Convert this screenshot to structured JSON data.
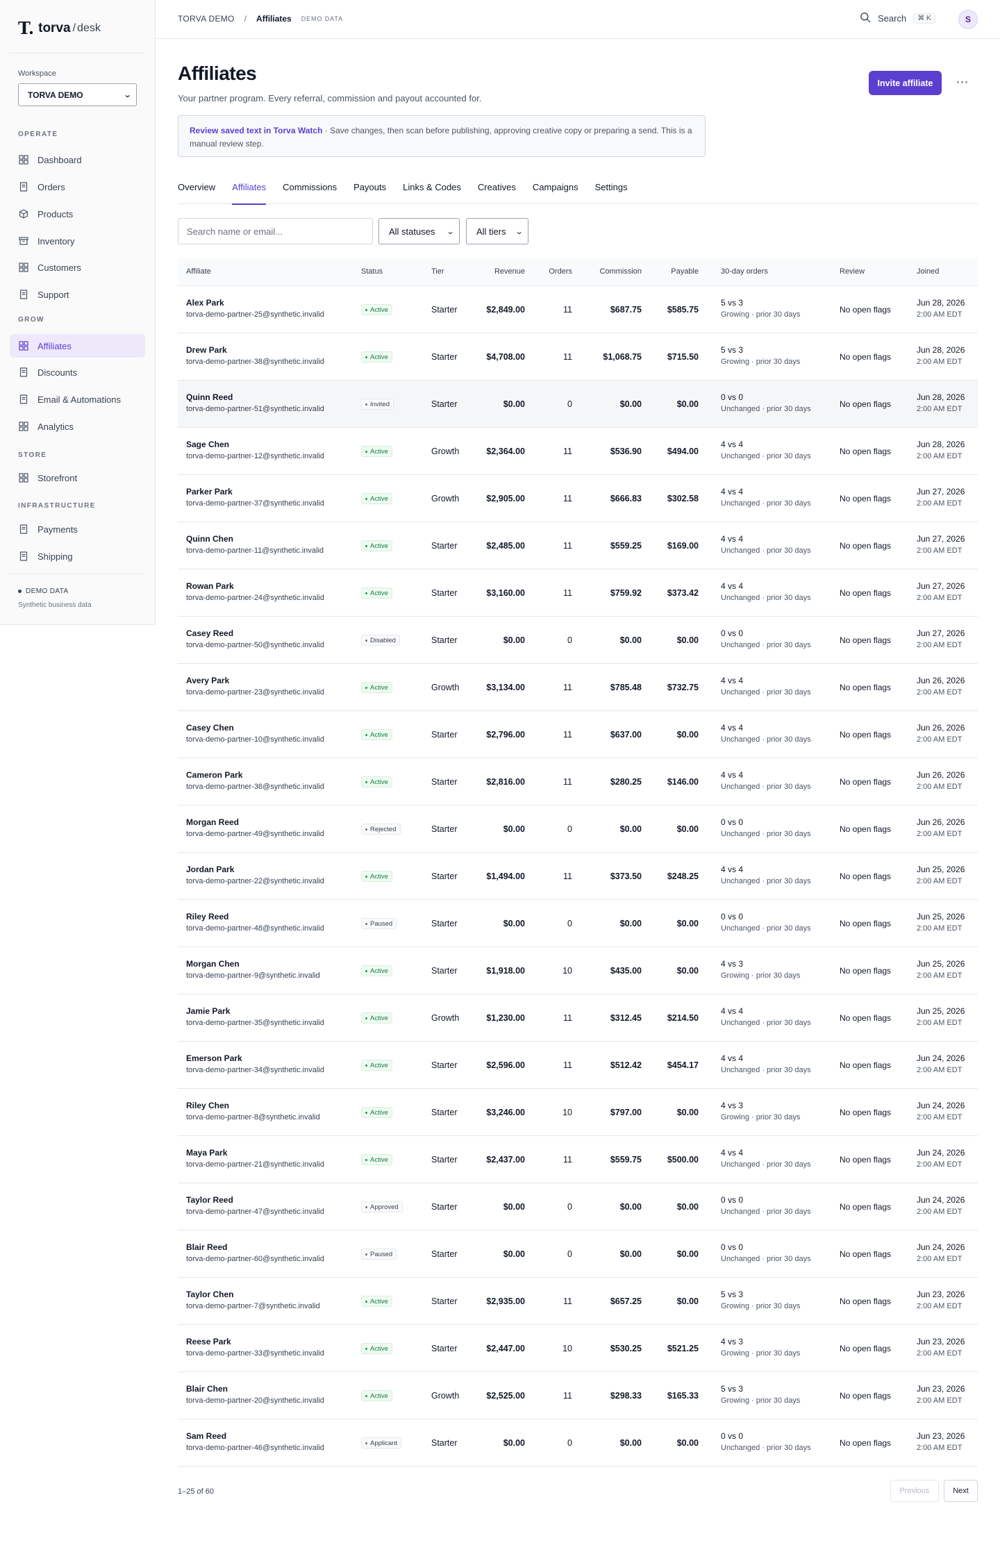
{
  "sidebar": {
    "logo_mark": "T.",
    "logo_name": "torva",
    "logo_sep": "/",
    "logo_sub": "desk",
    "workspace_label": "Workspace",
    "workspace_value": "TORVA DEMO",
    "sections": [
      {
        "label": "OPERATE",
        "items": [
          {
            "label": "Dashboard",
            "icon": "grid-icon"
          },
          {
            "label": "Orders",
            "icon": "document-icon"
          },
          {
            "label": "Products",
            "icon": "box-icon"
          },
          {
            "label": "Inventory",
            "icon": "archive-icon"
          },
          {
            "label": "Customers",
            "icon": "grid-icon"
          },
          {
            "label": "Support",
            "icon": "document-icon"
          }
        ]
      },
      {
        "label": "GROW",
        "items": [
          {
            "label": "Affiliates",
            "icon": "grid-icon"
          },
          {
            "label": "Discounts",
            "icon": "document-icon"
          },
          {
            "label": "Email & Automations",
            "icon": "document-icon"
          },
          {
            "label": "Analytics",
            "icon": "grid-icon"
          }
        ]
      },
      {
        "label": "STORE",
        "items": [
          {
            "label": "Storefront",
            "icon": "grid-icon"
          }
        ]
      },
      {
        "label": "INFRASTRUCTURE",
        "items": [
          {
            "label": "Payments",
            "icon": "document-icon"
          },
          {
            "label": "Shipping",
            "icon": "document-icon"
          }
        ]
      }
    ],
    "active_item": "Affiliates",
    "demo_flag": "DEMO DATA",
    "demo_sub": "Synthetic business data"
  },
  "topbar": {
    "workspace": "TORVA DEMO",
    "separator": "/",
    "current": "Affiliates",
    "demo_tag": "DEMO DATA",
    "search_label": "Search",
    "search_shortcut": "⌘ K",
    "avatar_initial": "S"
  },
  "header": {
    "title": "Affiliates",
    "subtitle": "Your partner program. Every referral, commission and payout accounted for.",
    "invite_label": "Invite affiliate",
    "more_label": "⋯"
  },
  "banner": {
    "strong": "Review saved text in Torva Watch",
    "text": " · Save changes, then scan before publishing, approving creative copy or preparing a send. This is a manual review step."
  },
  "tabs": [
    "Overview",
    "Affiliates",
    "Commissions",
    "Payouts",
    "Links & Codes",
    "Creatives",
    "Campaigns",
    "Settings"
  ],
  "active_tab": "Affiliates",
  "filters": {
    "search_placeholder": "Search name or email...",
    "status_value": "All statuses",
    "tier_value": "All tiers"
  },
  "table": {
    "columns": [
      "Affiliate",
      "Status",
      "Tier",
      "Revenue",
      "Orders",
      "Commission",
      "Payable",
      "30-day orders",
      "Review",
      "Joined"
    ],
    "rows": [
      {
        "name": "Alex Park",
        "email": "torva-demo-partner-25@synthetic.invalid",
        "status": "Active",
        "tier": "Starter",
        "revenue": "$2,849.00",
        "orders": "11",
        "commission": "$687.75",
        "payable": "$585.75",
        "t30": "5 vs 3",
        "trend": "Growing · prior 30 days",
        "review": "No open flags",
        "date": "Jun 28, 2026",
        "time": "2:00 AM EDT"
      },
      {
        "name": "Drew Park",
        "email": "torva-demo-partner-38@synthetic.invalid",
        "status": "Active",
        "tier": "Starter",
        "revenue": "$4,708.00",
        "orders": "11",
        "commission": "$1,068.75",
        "payable": "$715.50",
        "t30": "5 vs 3",
        "trend": "Growing · prior 30 days",
        "review": "No open flags",
        "date": "Jun 28, 2026",
        "time": "2:00 AM EDT"
      },
      {
        "name": "Quinn Reed",
        "email": "torva-demo-partner-51@synthetic.invalid",
        "status": "Invited",
        "tier": "Starter",
        "revenue": "$0.00",
        "orders": "0",
        "commission": "$0.00",
        "payable": "$0.00",
        "t30": "0 vs 0",
        "trend": "Unchanged · prior 30 days",
        "review": "No open flags",
        "date": "Jun 28, 2026",
        "time": "2:00 AM EDT"
      },
      {
        "name": "Sage Chen",
        "email": "torva-demo-partner-12@synthetic.invalid",
        "status": "Active",
        "tier": "Growth",
        "revenue": "$2,364.00",
        "orders": "11",
        "commission": "$536.90",
        "payable": "$494.00",
        "t30": "4 vs 4",
        "trend": "Unchanged · prior 30 days",
        "review": "No open flags",
        "date": "Jun 28, 2026",
        "time": "2:00 AM EDT"
      },
      {
        "name": "Parker Park",
        "email": "torva-demo-partner-37@synthetic.invalid",
        "status": "Active",
        "tier": "Growth",
        "revenue": "$2,905.00",
        "orders": "11",
        "commission": "$666.83",
        "payable": "$302.58",
        "t30": "4 vs 4",
        "trend": "Unchanged · prior 30 days",
        "review": "No open flags",
        "date": "Jun 27, 2026",
        "time": "2:00 AM EDT"
      },
      {
        "name": "Quinn Chen",
        "email": "torva-demo-partner-11@synthetic.invalid",
        "status": "Active",
        "tier": "Starter",
        "revenue": "$2,485.00",
        "orders": "11",
        "commission": "$559.25",
        "payable": "$169.00",
        "t30": "4 vs 4",
        "trend": "Unchanged · prior 30 days",
        "review": "No open flags",
        "date": "Jun 27, 2026",
        "time": "2:00 AM EDT"
      },
      {
        "name": "Rowan Park",
        "email": "torva-demo-partner-24@synthetic.invalid",
        "status": "Active",
        "tier": "Starter",
        "revenue": "$3,160.00",
        "orders": "11",
        "commission": "$759.92",
        "payable": "$373.42",
        "t30": "4 vs 4",
        "trend": "Unchanged · prior 30 days",
        "review": "No open flags",
        "date": "Jun 27, 2026",
        "time": "2:00 AM EDT"
      },
      {
        "name": "Casey Reed",
        "email": "torva-demo-partner-50@synthetic.invalid",
        "status": "Disabled",
        "tier": "Starter",
        "revenue": "$0.00",
        "orders": "0",
        "commission": "$0.00",
        "payable": "$0.00",
        "t30": "0 vs 0",
        "trend": "Unchanged · prior 30 days",
        "review": "No open flags",
        "date": "Jun 27, 2026",
        "time": "2:00 AM EDT"
      },
      {
        "name": "Avery Park",
        "email": "torva-demo-partner-23@synthetic.invalid",
        "status": "Active",
        "tier": "Growth",
        "revenue": "$3,134.00",
        "orders": "11",
        "commission": "$785.48",
        "payable": "$732.75",
        "t30": "4 vs 4",
        "trend": "Unchanged · prior 30 days",
        "review": "No open flags",
        "date": "Jun 26, 2026",
        "time": "2:00 AM EDT"
      },
      {
        "name": "Casey Chen",
        "email": "torva-demo-partner-10@synthetic.invalid",
        "status": "Active",
        "tier": "Starter",
        "revenue": "$2,796.00",
        "orders": "11",
        "commission": "$637.00",
        "payable": "$0.00",
        "t30": "4 vs 4",
        "trend": "Unchanged · prior 30 days",
        "review": "No open flags",
        "date": "Jun 26, 2026",
        "time": "2:00 AM EDT"
      },
      {
        "name": "Cameron Park",
        "email": "torva-demo-partner-36@synthetic.invalid",
        "status": "Active",
        "tier": "Starter",
        "revenue": "$2,816.00",
        "orders": "11",
        "commission": "$280.25",
        "payable": "$146.00",
        "t30": "4 vs 4",
        "trend": "Unchanged · prior 30 days",
        "review": "No open flags",
        "date": "Jun 26, 2026",
        "time": "2:00 AM EDT"
      },
      {
        "name": "Morgan Reed",
        "email": "torva-demo-partner-49@synthetic.invalid",
        "status": "Rejected",
        "tier": "Starter",
        "revenue": "$0.00",
        "orders": "0",
        "commission": "$0.00",
        "payable": "$0.00",
        "t30": "0 vs 0",
        "trend": "Unchanged · prior 30 days",
        "review": "No open flags",
        "date": "Jun 26, 2026",
        "time": "2:00 AM EDT"
      },
      {
        "name": "Jordan Park",
        "email": "torva-demo-partner-22@synthetic.invalid",
        "status": "Active",
        "tier": "Starter",
        "revenue": "$1,494.00",
        "orders": "11",
        "commission": "$373.50",
        "payable": "$248.25",
        "t30": "4 vs 4",
        "trend": "Unchanged · prior 30 days",
        "review": "No open flags",
        "date": "Jun 25, 2026",
        "time": "2:00 AM EDT"
      },
      {
        "name": "Riley Reed",
        "email": "torva-demo-partner-48@synthetic.invalid",
        "status": "Paused",
        "tier": "Starter",
        "revenue": "$0.00",
        "orders": "0",
        "commission": "$0.00",
        "payable": "$0.00",
        "t30": "0 vs 0",
        "trend": "Unchanged · prior 30 days",
        "review": "No open flags",
        "date": "Jun 25, 2026",
        "time": "2:00 AM EDT"
      },
      {
        "name": "Morgan Chen",
        "email": "torva-demo-partner-9@synthetic.invalid",
        "status": "Active",
        "tier": "Starter",
        "revenue": "$1,918.00",
        "orders": "10",
        "commission": "$435.00",
        "payable": "$0.00",
        "t30": "4 vs 3",
        "trend": "Growing · prior 30 days",
        "review": "No open flags",
        "date": "Jun 25, 2026",
        "time": "2:00 AM EDT"
      },
      {
        "name": "Jamie Park",
        "email": "torva-demo-partner-35@synthetic.invalid",
        "status": "Active",
        "tier": "Growth",
        "revenue": "$1,230.00",
        "orders": "11",
        "commission": "$312.45",
        "payable": "$214.50",
        "t30": "4 vs 4",
        "trend": "Unchanged · prior 30 days",
        "review": "No open flags",
        "date": "Jun 25, 2026",
        "time": "2:00 AM EDT"
      },
      {
        "name": "Emerson Park",
        "email": "torva-demo-partner-34@synthetic.invalid",
        "status": "Active",
        "tier": "Starter",
        "revenue": "$2,596.00",
        "orders": "11",
        "commission": "$512.42",
        "payable": "$454.17",
        "t30": "4 vs 4",
        "trend": "Unchanged · prior 30 days",
        "review": "No open flags",
        "date": "Jun 24, 2026",
        "time": "2:00 AM EDT"
      },
      {
        "name": "Riley Chen",
        "email": "torva-demo-partner-8@synthetic.invalid",
        "status": "Active",
        "tier": "Starter",
        "revenue": "$3,246.00",
        "orders": "10",
        "commission": "$797.00",
        "payable": "$0.00",
        "t30": "4 vs 3",
        "trend": "Growing · prior 30 days",
        "review": "No open flags",
        "date": "Jun 24, 2026",
        "time": "2:00 AM EDT"
      },
      {
        "name": "Maya Park",
        "email": "torva-demo-partner-21@synthetic.invalid",
        "status": "Active",
        "tier": "Starter",
        "revenue": "$2,437.00",
        "orders": "11",
        "commission": "$559.75",
        "payable": "$500.00",
        "t30": "4 vs 4",
        "trend": "Unchanged · prior 30 days",
        "review": "No open flags",
        "date": "Jun 24, 2026",
        "time": "2:00 AM EDT"
      },
      {
        "name": "Taylor Reed",
        "email": "torva-demo-partner-47@synthetic.invalid",
        "status": "Approved",
        "tier": "Starter",
        "revenue": "$0.00",
        "orders": "0",
        "commission": "$0.00",
        "payable": "$0.00",
        "t30": "0 vs 0",
        "trend": "Unchanged · prior 30 days",
        "review": "No open flags",
        "date": "Jun 24, 2026",
        "time": "2:00 AM EDT"
      },
      {
        "name": "Blair Reed",
        "email": "torva-demo-partner-60@synthetic.invalid",
        "status": "Paused",
        "tier": "Starter",
        "revenue": "$0.00",
        "orders": "0",
        "commission": "$0.00",
        "payable": "$0.00",
        "t30": "0 vs 0",
        "trend": "Unchanged · prior 30 days",
        "review": "No open flags",
        "date": "Jun 24, 2026",
        "time": "2:00 AM EDT"
      },
      {
        "name": "Taylor Chen",
        "email": "torva-demo-partner-7@synthetic.invalid",
        "status": "Active",
        "tier": "Starter",
        "revenue": "$2,935.00",
        "orders": "11",
        "commission": "$657.25",
        "payable": "$0.00",
        "t30": "5 vs 3",
        "trend": "Growing · prior 30 days",
        "review": "No open flags",
        "date": "Jun 23, 2026",
        "time": "2:00 AM EDT"
      },
      {
        "name": "Reese Park",
        "email": "torva-demo-partner-33@synthetic.invalid",
        "status": "Active",
        "tier": "Starter",
        "revenue": "$2,447.00",
        "orders": "10",
        "commission": "$530.25",
        "payable": "$521.25",
        "t30": "4 vs 3",
        "trend": "Growing · prior 30 days",
        "review": "No open flags",
        "date": "Jun 23, 2026",
        "time": "2:00 AM EDT"
      },
      {
        "name": "Blair Chen",
        "email": "torva-demo-partner-20@synthetic.invalid",
        "status": "Active",
        "tier": "Growth",
        "revenue": "$2,525.00",
        "orders": "11",
        "commission": "$298.33",
        "payable": "$165.33",
        "t30": "5 vs 3",
        "trend": "Growing · prior 30 days",
        "review": "No open flags",
        "date": "Jun 23, 2026",
        "time": "2:00 AM EDT"
      },
      {
        "name": "Sam Reed",
        "email": "torva-demo-partner-46@synthetic.invalid",
        "status": "Applicant",
        "tier": "Starter",
        "revenue": "$0.00",
        "orders": "0",
        "commission": "$0.00",
        "payable": "$0.00",
        "t30": "0 vs 0",
        "trend": "Unchanged · prior 30 days",
        "review": "No open flags",
        "date": "Jun 23, 2026",
        "time": "2:00 AM EDT"
      }
    ]
  },
  "pagination": {
    "info": "1–25 of 60",
    "prev_label": "Previous",
    "next_label": "Next"
  },
  "colors": {
    "accent": "#5b3fd0",
    "active_badge": "#15803d"
  }
}
